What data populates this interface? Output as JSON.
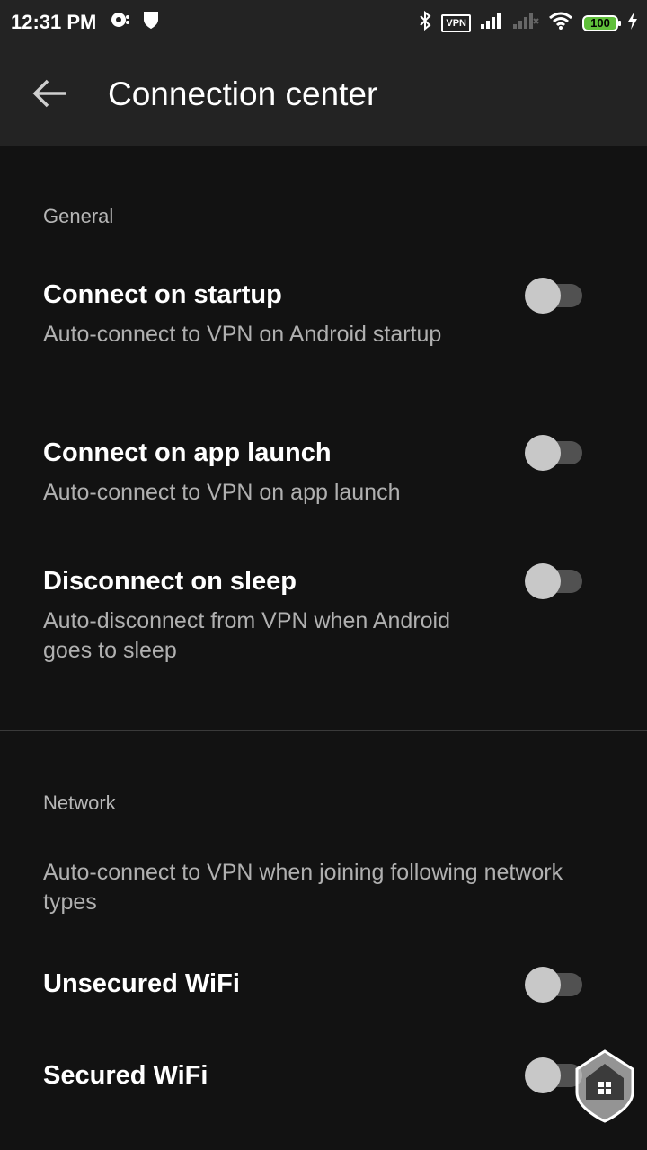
{
  "status_bar": {
    "time": "12:31 PM",
    "vpn_label": "VPN",
    "battery": "100"
  },
  "header": {
    "title": "Connection center",
    "back_icon": "arrow-left-icon"
  },
  "general": {
    "header": "General",
    "items": [
      {
        "title": "Connect on startup",
        "desc": "Auto-connect to VPN on Android startup",
        "enabled": false
      },
      {
        "title": "Connect on app launch",
        "desc": "Auto-connect to VPN on app launch",
        "enabled": false
      },
      {
        "title": "Disconnect on sleep",
        "desc": "Auto-disconnect from VPN when Android goes to sleep",
        "enabled": false
      }
    ]
  },
  "network": {
    "header": "Network",
    "desc": "Auto-connect to VPN when joining following network types",
    "items": [
      {
        "title": "Unsecured WiFi",
        "enabled": false
      },
      {
        "title": "Secured WiFi",
        "enabled": false
      }
    ]
  },
  "colors": {
    "background": "#121212",
    "app_bar": "#232323",
    "battery": "#5fbf3a"
  }
}
